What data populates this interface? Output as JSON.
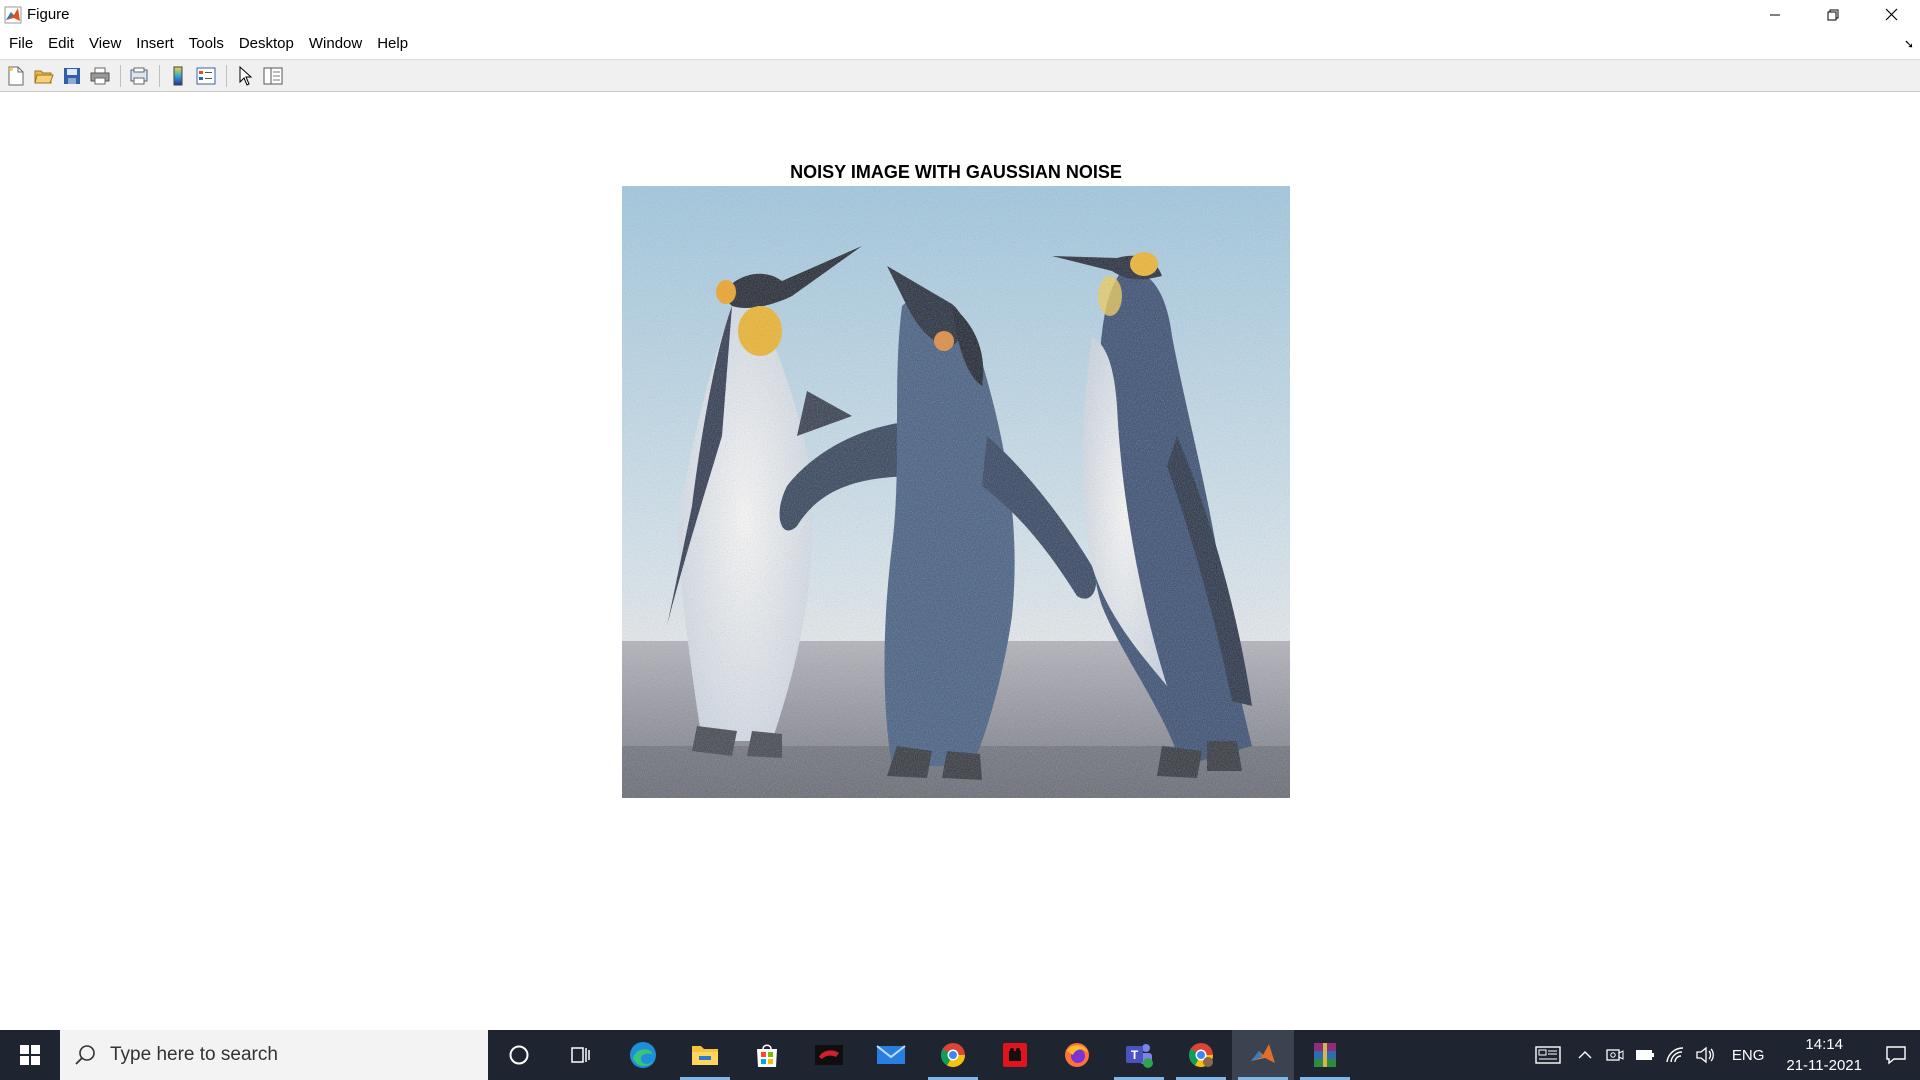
{
  "window": {
    "title": "Figure"
  },
  "menu": [
    "File",
    "Edit",
    "View",
    "Insert",
    "Tools",
    "Desktop",
    "Window",
    "Help"
  ],
  "toolbar": [
    "new-figure-icon",
    "open-file-icon",
    "save-icon",
    "print-icon",
    "print-preview-icon",
    "colorbar-icon",
    "legend-icon",
    "edit-plot-arrow-icon",
    "property-inspector-icon"
  ],
  "plot": {
    "title": "NOISY IMAGE WITH GAUSSIAN NOISE"
  },
  "taskbar": {
    "search_placeholder": "Type here to search",
    "apps": [
      "cortana-icon",
      "task-view-icon",
      "edge-icon",
      "file-explorer-icon",
      "microsoft-store-icon",
      "game-app-icon",
      "mail-icon",
      "chrome-icon",
      "red-app-icon",
      "firefox-icon",
      "teams-icon",
      "chrome-profile-icon",
      "matlab-icon",
      "winrar-icon"
    ],
    "language": "ENG",
    "time": "14:14",
    "date": "21-11-2021"
  },
  "colors": {
    "taskbar": "#1f2530",
    "toolbar": "#f0f0f0",
    "accent": "#7fb7e8"
  }
}
